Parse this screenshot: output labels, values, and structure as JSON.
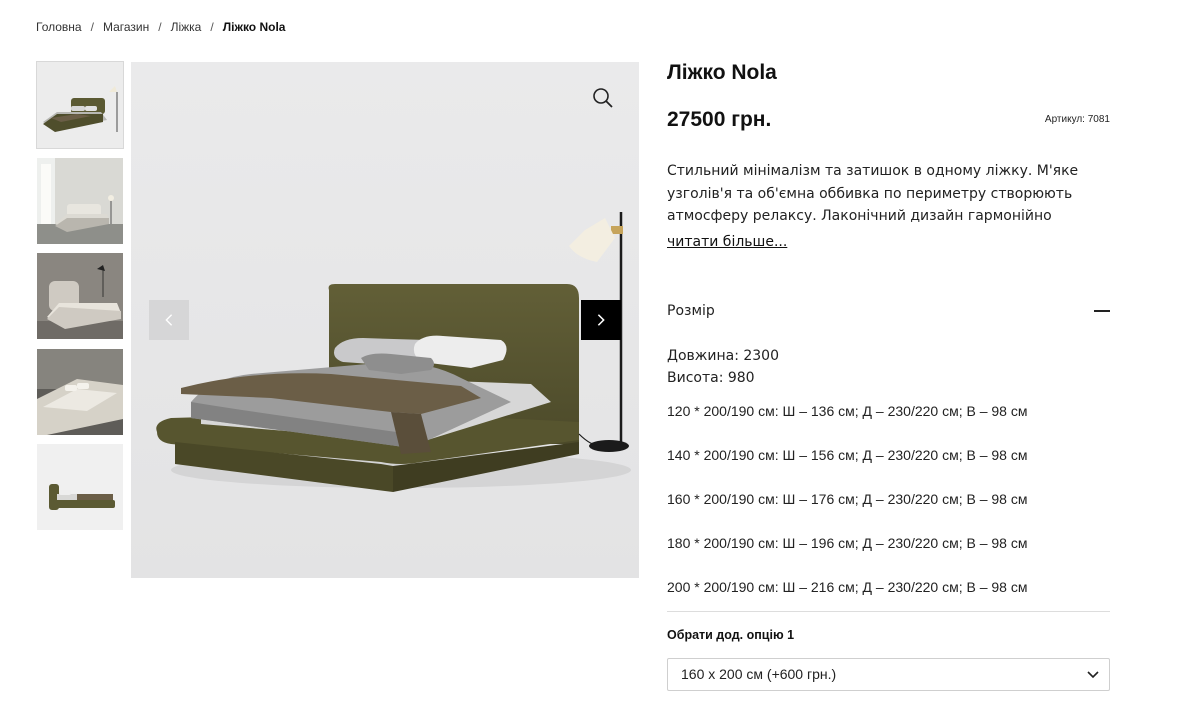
{
  "breadcrumb": {
    "items": [
      "Головна",
      "Магазин",
      "Ліжка"
    ],
    "current": "Ліжко Nola",
    "separator": "/"
  },
  "product": {
    "title": "Ліжко Nola",
    "price": "27500 грн.",
    "sku": "Артикул: 7081",
    "description": "Стильний мінімалізм та затишок в одному ліжку. М'яке узголів'я та об'ємна оббивка по периметру створюють атмосферу релаксу. Лаконічний дизайн гармонійно",
    "read_more": "читати більше..."
  },
  "gallery": {
    "thumbnail_count": 5,
    "active_index": 0,
    "icons": {
      "zoom": "zoom-icon",
      "prev": "chevron-left-icon",
      "next": "chevron-right-icon"
    }
  },
  "size_section": {
    "title": "Розмір",
    "toggle_icon": "minus-icon",
    "length": "Довжина: 2300",
    "height": "Висота: 980",
    "sizes": [
      "120 * 200/190 см: Ш – 136 см; Д – 230/220 см; В – 98 см",
      "140 * 200/190 см: Ш – 156 см; Д – 230/220 см; В – 98 см",
      "160 * 200/190 см: Ш – 176 см; Д – 230/220 см; В – 98 см",
      "180 * 200/190 см: Ш – 196 см; Д – 230/220 см; В – 98 см",
      "200 * 200/190 см: Ш – 216 см; Д – 230/220 см; В – 98 см"
    ]
  },
  "option": {
    "label": "Обрати дод. опцію 1",
    "selected": "160 x 200 см (+600 грн.)"
  },
  "colors": {
    "fabric_olive": "#5b5a33",
    "background_gray": "#e9e9ea",
    "accent_black": "#000000"
  }
}
